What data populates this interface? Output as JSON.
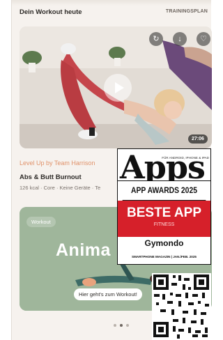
{
  "header": {
    "title": "Dein Workout heute",
    "link_label": "TRAININGSPLAN"
  },
  "video_card": {
    "duration": "27:06",
    "icons": [
      "sync-icon",
      "download-icon",
      "heart-icon",
      "play-icon"
    ]
  },
  "workout": {
    "series": "Level Up by Team Harrison",
    "title": "Abs & Butt Burnout",
    "details": "126 kcal · Core · Keine Geräte · Te"
  },
  "promo": {
    "tag": "Workout",
    "headline": "Anima",
    "cta": "Hier geht's zum Workout!"
  },
  "carousel": {
    "page_count": 3,
    "active_index": 1
  },
  "badge": {
    "top_small": "FÜR ANDROID, IPHONE & IPAD",
    "logo": "Apps",
    "awards": "APP AWARDS 2025",
    "winner": "BESTE APP",
    "category": "FITNESS",
    "brand": "Gymondo",
    "magazine": "SMARTPHONE MAGAZIN | JAN./FEB. 2025"
  },
  "colors": {
    "accent": "#e0926a",
    "badge_red": "#d6202a",
    "promo_green": "#9fb69b"
  }
}
